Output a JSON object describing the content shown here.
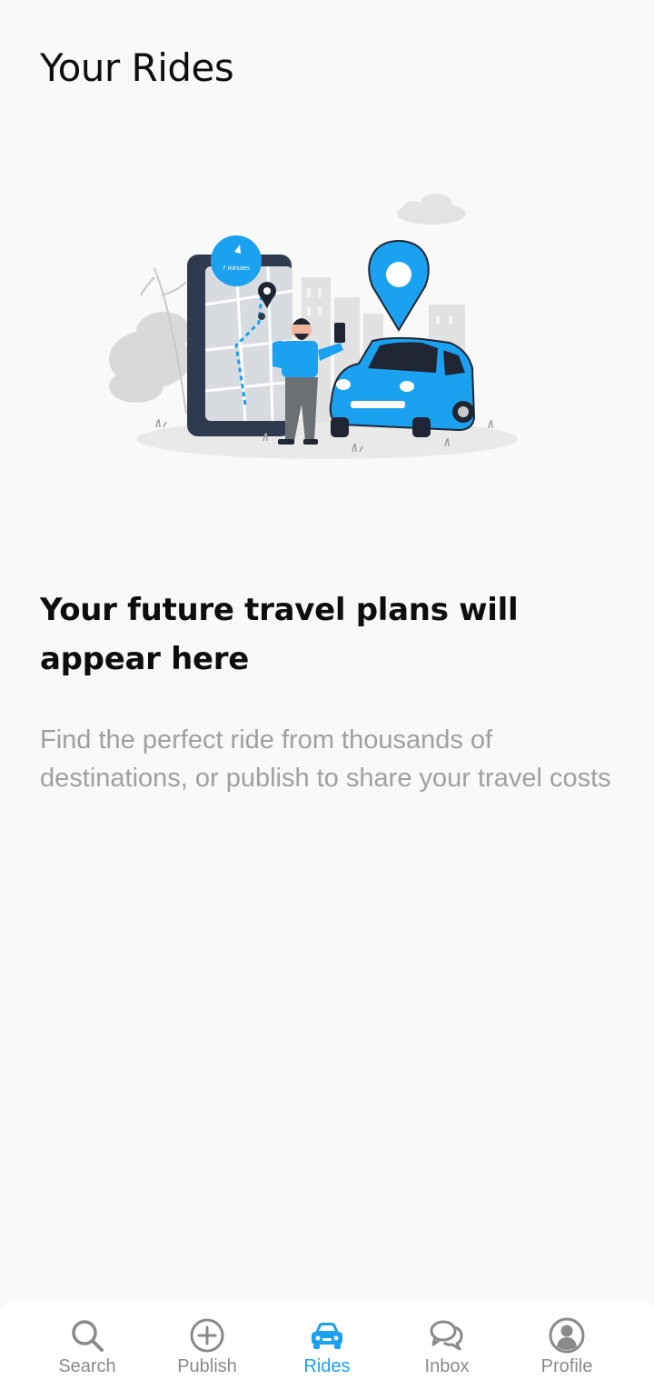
{
  "header": {
    "title": "Your Rides"
  },
  "empty_state": {
    "heading": "Your future travel plans will appear here",
    "body": "Find the perfect ride from thousands of destinations, or publish to share your travel costs",
    "illustration_badge": "7 minutes"
  },
  "bottom_nav": {
    "active": "rides",
    "items": [
      {
        "id": "search",
        "label": "Search",
        "icon": "search-icon"
      },
      {
        "id": "publish",
        "label": "Publish",
        "icon": "plus-circle-icon"
      },
      {
        "id": "rides",
        "label": "Rides",
        "icon": "car-icon"
      },
      {
        "id": "inbox",
        "label": "Inbox",
        "icon": "chat-bubbles-icon"
      },
      {
        "id": "profile",
        "label": "Profile",
        "icon": "user-circle-icon"
      }
    ]
  },
  "colors": {
    "accent": "#1aa1ef",
    "inactive": "#8a8a8a",
    "text_primary": "#0d0d0d",
    "text_secondary": "#a0a0a0",
    "background": "#f9f9f9"
  }
}
